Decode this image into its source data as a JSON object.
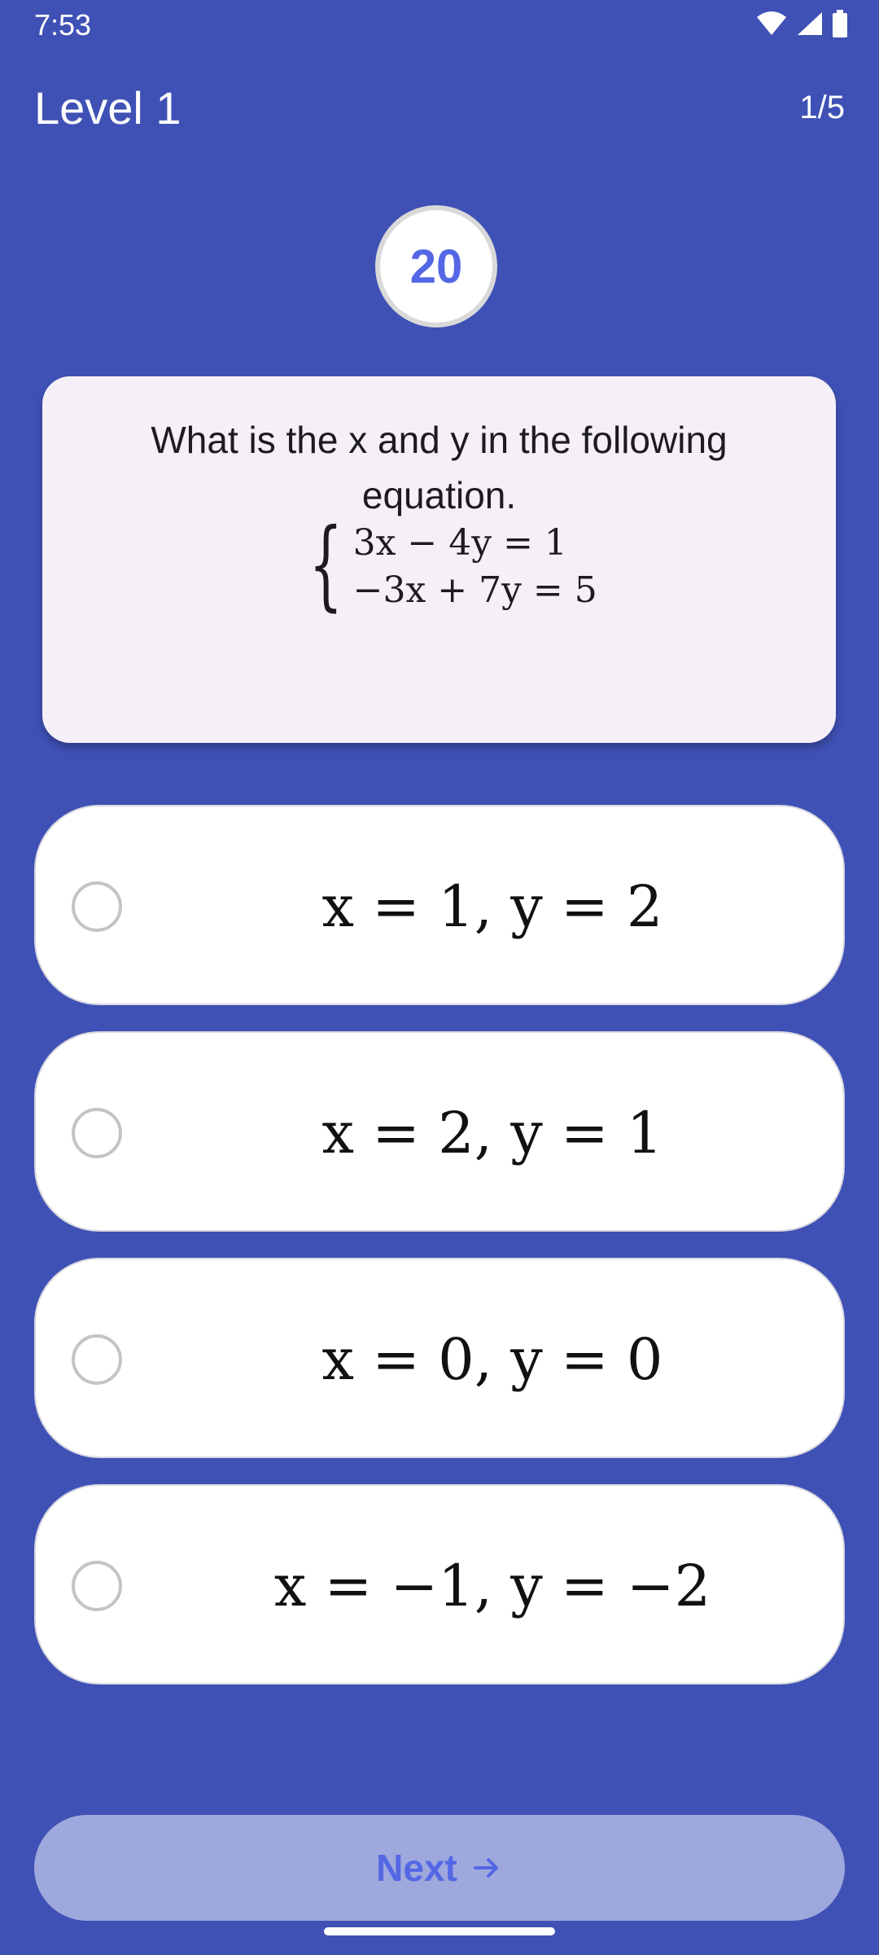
{
  "status_bar": {
    "time": "7:53"
  },
  "header": {
    "title": "Level 1",
    "progress": "1/5"
  },
  "timer": {
    "value": "20"
  },
  "question": {
    "text": "What is the x and y in the following equation.",
    "equation_lines": [
      "3x − 4y = 1",
      "−3x + 7y = 5"
    ]
  },
  "options": [
    {
      "label": "x = 1, y = 2"
    },
    {
      "label": "x = 2, y = 1"
    },
    {
      "label": "x = 0, y = 0"
    },
    {
      "label": "x = −1, y = −2"
    }
  ],
  "next_button": {
    "label": "Next"
  },
  "colors": {
    "background": "#3f51b5",
    "card": "#f5f0f8",
    "accent": "#5468e6",
    "button_disabled": "#9fa8dc"
  }
}
